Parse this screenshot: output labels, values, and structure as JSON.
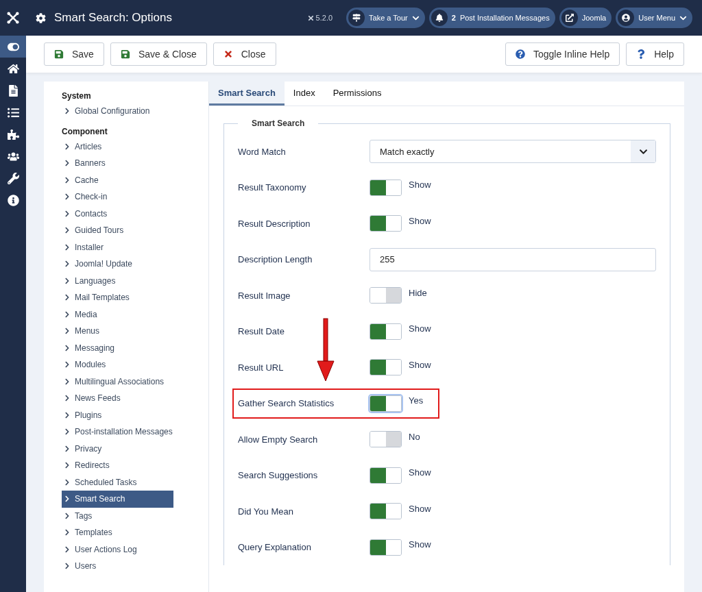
{
  "header": {
    "title": "Smart Search: Options",
    "version": "5.2.0",
    "buttons": [
      {
        "kind": "tour",
        "label": "Take a Tour"
      },
      {
        "kind": "messages",
        "count": "2",
        "label": "Post Installation Messages"
      },
      {
        "kind": "site",
        "label": "Joomla"
      },
      {
        "kind": "user",
        "label": "User Menu"
      }
    ]
  },
  "rail": [
    {
      "kind": "toggle",
      "selected": true
    },
    {
      "kind": "home",
      "selected": false
    },
    {
      "kind": "content",
      "selected": false
    },
    {
      "kind": "menus",
      "selected": false
    },
    {
      "kind": "components",
      "selected": false
    },
    {
      "kind": "users",
      "selected": false
    },
    {
      "kind": "system",
      "selected": false
    },
    {
      "kind": "help",
      "selected": false
    }
  ],
  "toolbar": {
    "left": [
      {
        "kind": "save",
        "label": "Save"
      },
      {
        "kind": "save",
        "label": "Save & Close"
      },
      {
        "kind": "close",
        "label": "Close"
      }
    ],
    "right": [
      {
        "kind": "inline-help",
        "label": "Toggle Inline Help"
      },
      {
        "kind": "help",
        "label": "Help"
      }
    ]
  },
  "sidebar": [
    {
      "heading": "System",
      "items": [
        {
          "label": "Global Configuration",
          "selected": false
        }
      ]
    },
    {
      "heading": "Component",
      "items": [
        {
          "label": "Articles",
          "selected": false
        },
        {
          "label": "Banners",
          "selected": false
        },
        {
          "label": "Cache",
          "selected": false
        },
        {
          "label": "Check-in",
          "selected": false
        },
        {
          "label": "Contacts",
          "selected": false
        },
        {
          "label": "Guided Tours",
          "selected": false
        },
        {
          "label": "Installer",
          "selected": false
        },
        {
          "label": "Joomla! Update",
          "selected": false
        },
        {
          "label": "Languages",
          "selected": false
        },
        {
          "label": "Mail Templates",
          "selected": false
        },
        {
          "label": "Media",
          "selected": false
        },
        {
          "label": "Menus",
          "selected": false
        },
        {
          "label": "Messaging",
          "selected": false
        },
        {
          "label": "Modules",
          "selected": false
        },
        {
          "label": "Multilingual Associations",
          "selected": false
        },
        {
          "label": "News Feeds",
          "selected": false
        },
        {
          "label": "Plugins",
          "selected": false
        },
        {
          "label": "Post-installation Messages",
          "selected": false
        },
        {
          "label": "Privacy",
          "selected": false
        },
        {
          "label": "Redirects",
          "selected": false
        },
        {
          "label": "Scheduled Tasks",
          "selected": false
        },
        {
          "label": "Smart Search",
          "selected": true
        },
        {
          "label": "Tags",
          "selected": false
        },
        {
          "label": "Templates",
          "selected": false
        },
        {
          "label": "User Actions Log",
          "selected": false
        },
        {
          "label": "Users",
          "selected": false
        }
      ]
    }
  ],
  "tabs": [
    {
      "label": "Smart Search",
      "selected": true
    },
    {
      "label": "Index",
      "selected": false
    },
    {
      "label": "Permissions",
      "selected": false
    }
  ],
  "fieldset": {
    "legend": "Smart Search",
    "fields": [
      {
        "kind": "select",
        "label": "Word Match",
        "value": "Match exactly",
        "highlighted": false
      },
      {
        "kind": "toggle",
        "label": "Result Taxonomy",
        "on": true,
        "value": "Show",
        "highlighted": false
      },
      {
        "kind": "toggle",
        "label": "Result Description",
        "on": true,
        "value": "Show",
        "highlighted": false
      },
      {
        "kind": "text",
        "label": "Description Length",
        "value": "255",
        "highlighted": false
      },
      {
        "kind": "toggle",
        "label": "Result Image",
        "on": false,
        "value": "Hide",
        "highlighted": false
      },
      {
        "kind": "toggle",
        "label": "Result Date",
        "on": true,
        "value": "Show",
        "highlighted": false
      },
      {
        "kind": "toggle",
        "label": "Result URL",
        "on": true,
        "value": "Show",
        "highlighted": false
      },
      {
        "kind": "toggle",
        "label": "Gather Search Statistics",
        "on": true,
        "value": "Yes",
        "highlighted": true
      },
      {
        "kind": "toggle",
        "label": "Allow Empty Search",
        "on": false,
        "value": "No",
        "highlighted": false
      },
      {
        "kind": "toggle",
        "label": "Search Suggestions",
        "on": true,
        "value": "Show",
        "highlighted": false
      },
      {
        "kind": "toggle",
        "label": "Did You Mean",
        "on": true,
        "value": "Show",
        "highlighted": false
      },
      {
        "kind": "toggle",
        "label": "Query Explanation",
        "on": true,
        "value": "Show",
        "highlighted": false
      }
    ]
  }
}
